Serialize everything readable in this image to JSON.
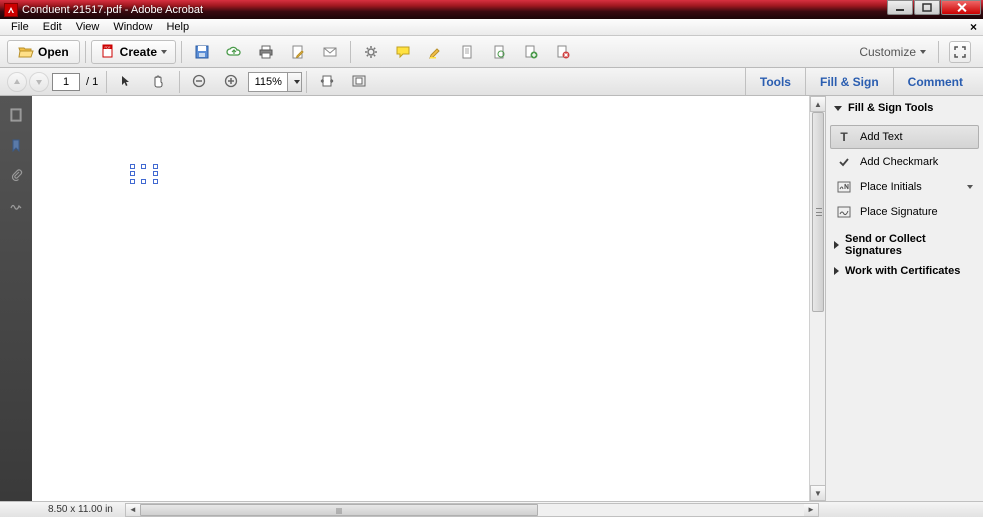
{
  "title": "Conduent 21517.pdf - Adobe Acrobat",
  "menubar": [
    "File",
    "Edit",
    "View",
    "Window",
    "Help"
  ],
  "toolbar": {
    "open": "Open",
    "create": "Create",
    "customize": "Customize"
  },
  "nav": {
    "page_current": "1",
    "page_total": "/ 1",
    "zoom": "115%"
  },
  "right_tabs": {
    "tools": "Tools",
    "fill_sign": "Fill & Sign",
    "comment": "Comment"
  },
  "side_panel": {
    "header": "Fill & Sign Tools",
    "items": {
      "add_text": "Add Text",
      "add_checkmark": "Add Checkmark",
      "place_initials": "Place Initials",
      "place_signature": "Place Signature"
    },
    "sections": {
      "send_collect": "Send or Collect Signatures",
      "certificates": "Work with Certificates"
    }
  },
  "statusbar": {
    "dimensions": "8.50 x 11.00 in"
  }
}
